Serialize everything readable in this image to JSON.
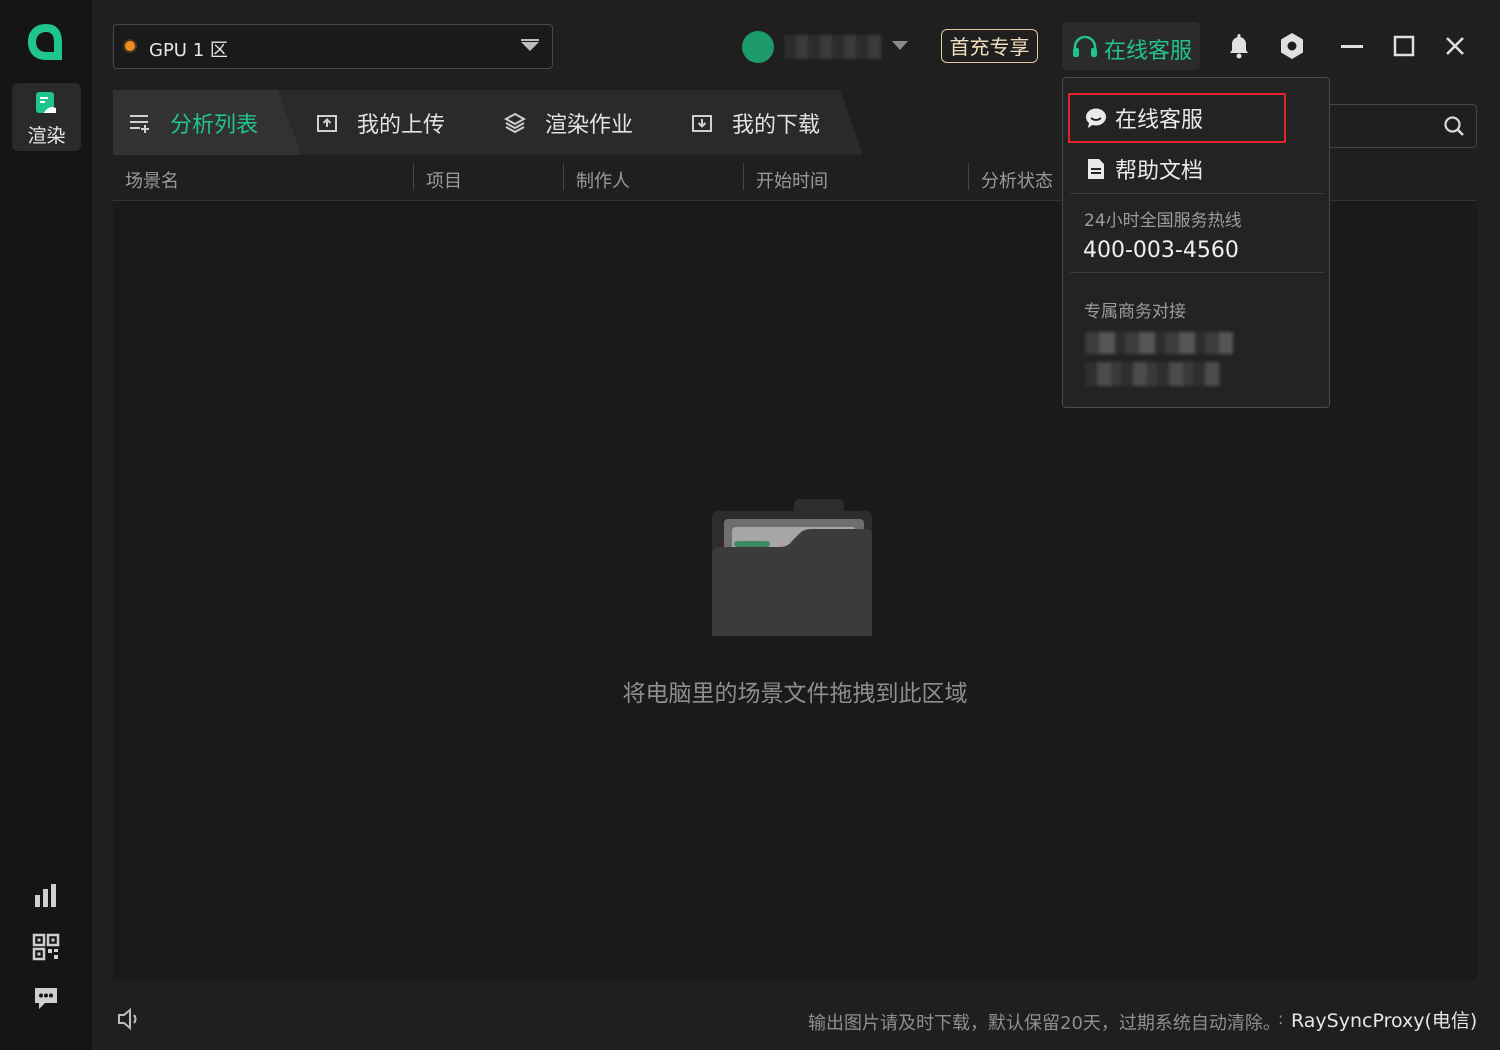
{
  "sidebar": {
    "items": [
      {
        "label": "渲染",
        "icon": "render-icon",
        "active": true
      }
    ],
    "bottom_icons": [
      "bar-chart-icon",
      "qr-code-icon",
      "chat-icon"
    ]
  },
  "header": {
    "region": {
      "label": "GPU 1 区",
      "status_color": "#f08a24"
    },
    "first_charge_label": "首充专享",
    "support_label": "在线客服",
    "icons": [
      "bell-icon",
      "settings-icon",
      "minimize-icon",
      "maximize-icon",
      "close-icon"
    ]
  },
  "tabs": [
    {
      "label": "分析列表",
      "icon": "list-icon",
      "active": true
    },
    {
      "label": "我的上传",
      "icon": "upload-icon",
      "active": false
    },
    {
      "label": "渲染作业",
      "icon": "layers-icon",
      "active": false
    },
    {
      "label": "我的下载",
      "icon": "download-icon",
      "active": false
    }
  ],
  "table": {
    "columns": [
      "场景名",
      "项目",
      "制作人",
      "开始时间",
      "分析状态"
    ]
  },
  "empty_state": {
    "text": "将电脑里的场景文件拖拽到此区域",
    "icon": "folder-icon"
  },
  "footer": {
    "notice": "输出图片请及时下载，默认保留20天，过期系统自动清除。",
    "separator": ":",
    "proxy": "RaySyncProxy(电信)"
  },
  "support_menu": {
    "items": [
      {
        "label": "在线客服",
        "icon": "chat-bubble-icon",
        "highlighted": true
      },
      {
        "label": "帮助文档",
        "icon": "document-icon",
        "highlighted": false
      }
    ],
    "hotline_caption": "24小时全国服务热线",
    "hotline_number": "400-003-4560",
    "business_caption": "专属商务对接"
  },
  "colors": {
    "accent": "#22c38e",
    "highlight_border": "#e0242a",
    "gold": "#e4c79a"
  }
}
